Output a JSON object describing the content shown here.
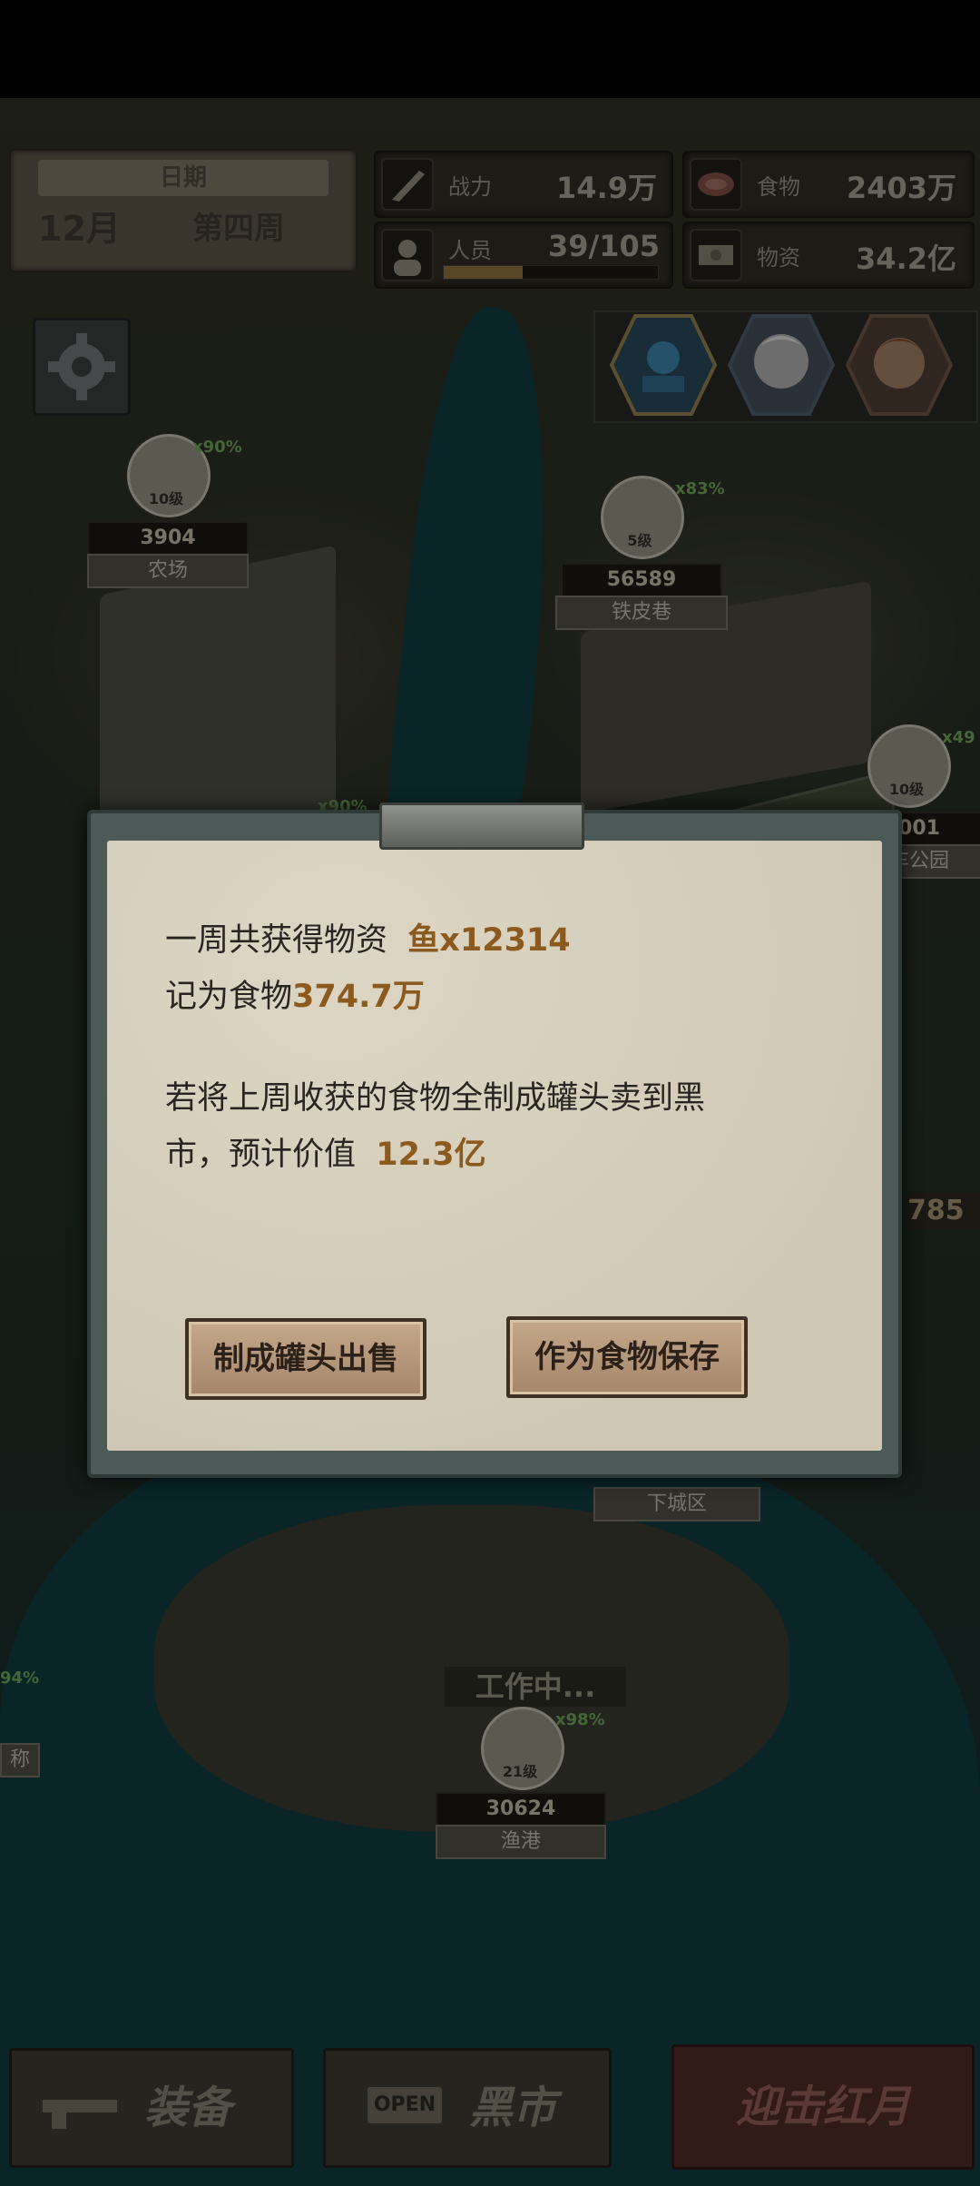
{
  "hud": {
    "date_label": "日期",
    "month": "12月",
    "week": "第四周",
    "combat_label": "战力",
    "combat_value": "14.9万",
    "people_label": "人员",
    "people_value": "39/105",
    "people_progress": 0.37,
    "food_label": "食物",
    "food_value": "2403万",
    "supplies_label": "物资",
    "supplies_value": "34.2亿"
  },
  "map": {
    "farm": {
      "level": "10级",
      "pct": "x90%",
      "value": "3904",
      "name": "农场"
    },
    "tinlane": {
      "level": "5级",
      "pct": "x83%",
      "value": "56589",
      "name": "铁皮巷"
    },
    "carpark": {
      "level": "10级",
      "pct": "x49",
      "value": "001",
      "name": "车公园"
    },
    "mid": {
      "pct": "x90%"
    },
    "right_value": "785",
    "downtown": {
      "name": "下城区"
    },
    "harbor": {
      "status": "工作中...",
      "level": "21级",
      "pct": "x98%",
      "value": "30624",
      "name": "渔港"
    },
    "left_pct": "94%",
    "left_name": "称"
  },
  "dialog": {
    "line1_prefix": "一周共获得物资",
    "line1_item": "鱼x12314",
    "line2_prefix": "记为食物",
    "line2_value": "374.7万",
    "line3": "若将上周收获的食物全制成罐头卖到黑",
    "line4_prefix": "市，预计价值",
    "line4_value": "12.3亿",
    "btn_sell": "制成罐头出售",
    "btn_keep": "作为食物保存"
  },
  "nav": {
    "equipment": "装备",
    "open_sign": "OPEN",
    "blackmarket": "黑市",
    "raid": "迎击红月"
  },
  "colors": {
    "accent": "#8b5a1f",
    "pct_green": "#6a9e55"
  }
}
